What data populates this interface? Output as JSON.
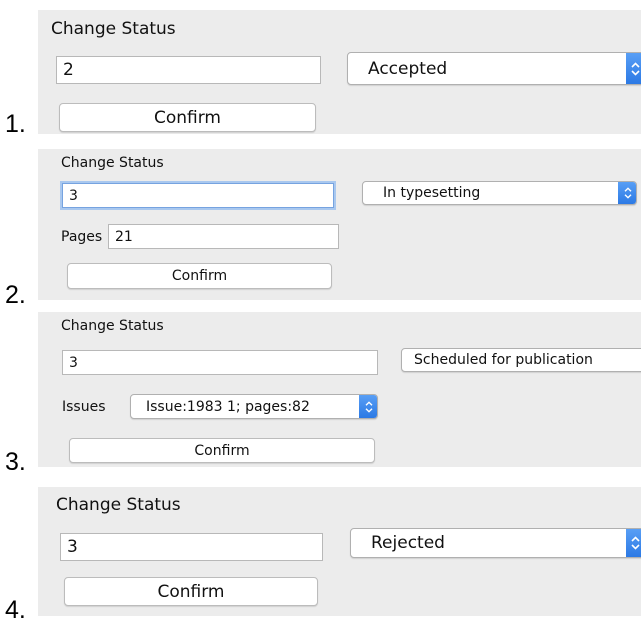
{
  "panels": [
    {
      "number": "1.",
      "title": "Change Status",
      "status_input_value": "2",
      "status_select_value": "Accepted",
      "confirm_label": "Confirm"
    },
    {
      "number": "2.",
      "title": "Change Status",
      "status_input_value": "3",
      "status_select_value": "In typesetting",
      "pages_label": "Pages",
      "pages_value": "21",
      "confirm_label": "Confirm"
    },
    {
      "number": "3.",
      "title": "Change Status",
      "status_input_value": "3",
      "status_select_value": "Scheduled for publication",
      "issues_label": "Issues",
      "issues_select_value": "Issue:1983 1; pages:82",
      "confirm_label": "Confirm"
    },
    {
      "number": "4.",
      "title": "Change Status",
      "status_input_value": "3",
      "status_select_value": "Rejected",
      "confirm_label": "Confirm"
    }
  ],
  "colors": {
    "panel_bg": "#ececec",
    "select_arrow": "#2a78e4",
    "focus_ring": "#a9c8ef"
  },
  "icons": {
    "select_arrow": "up-down-chevron-icon"
  }
}
